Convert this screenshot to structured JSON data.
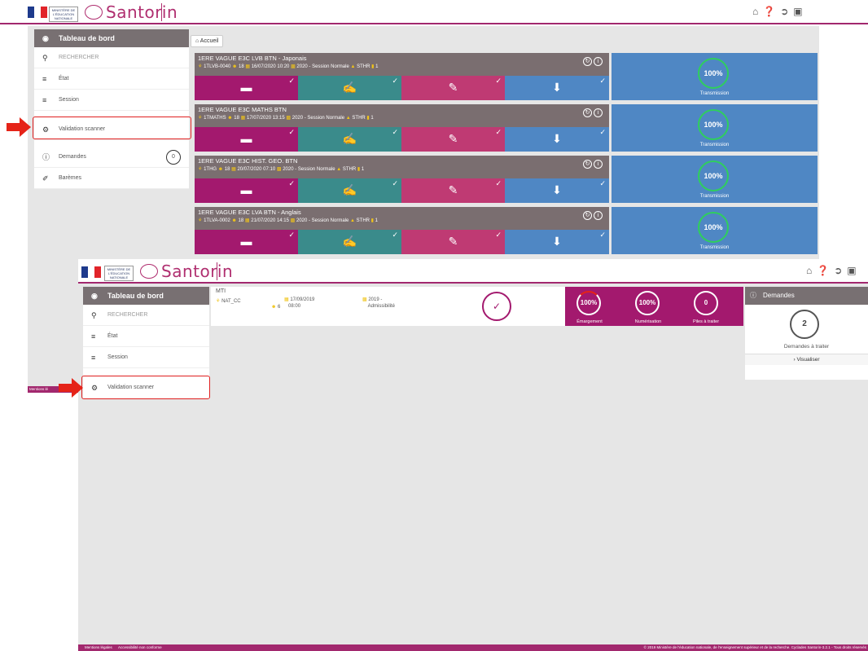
{
  "top": {
    "header": {
      "logo_text": "Santorin",
      "ministry_text": "MINISTÈRE DE L'ÉDUCATION NATIONALE",
      "icons": [
        "home-icon",
        "help-icon",
        "logout-icon",
        "window-icon"
      ]
    },
    "sidebar": {
      "title": "Tableau de bord",
      "items": [
        {
          "icon": "search-icon",
          "label": "RECHERCHER"
        },
        {
          "icon": "list-icon",
          "label": "État"
        },
        {
          "icon": "list-icon",
          "label": "Session"
        },
        {
          "icon": "gear-icon",
          "label": "Validation scanner"
        },
        {
          "icon": "alert-icon",
          "label": "Demandes",
          "badge": "0"
        },
        {
          "icon": "brush-icon",
          "label": "Barèmes"
        }
      ]
    },
    "breadcrumb": {
      "label": "Accueil"
    },
    "exams": [
      {
        "title": "1ERE VAGUE E3C LVB BTN - Japonais",
        "code": "1TLVB-0040",
        "count": "18",
        "date": "16/07/2020 10:20",
        "session": "2020 - Session Normale",
        "center": "STHR",
        "piles": "1"
      },
      {
        "title": "1ERE VAGUE E3C MATHS BTN",
        "code": "1TMATHS",
        "count": "18",
        "date": "17/07/2020 13:15",
        "session": "2020 - Session Normale",
        "center": "STHR",
        "piles": "1"
      },
      {
        "title": "1ERE VAGUE E3C HIST. GEO. BTN",
        "code": "1THG",
        "count": "18",
        "date": "20/07/2020 07:10",
        "session": "2020 - Session Normale",
        "center": "STHR",
        "piles": "1"
      },
      {
        "title": "1ERE VAGUE E3C LVA BTN - Anglais",
        "code": "1TLVA-0002",
        "count": "18",
        "date": "21/07/2020 14:15",
        "session": "2020 - Session Normale",
        "center": "STHR",
        "piles": "1"
      }
    ],
    "transmission": {
      "value": "100%",
      "label": "Transmission"
    }
  },
  "bottom": {
    "header": {
      "logo_text": "Santorin",
      "ministry_text": "MINISTÈRE DE L'ÉDUCATION NATIONALE"
    },
    "sidebar": {
      "title": "Tableau de bord",
      "items": [
        {
          "icon": "search-icon",
          "label": "RECHERCHER"
        },
        {
          "icon": "list-icon",
          "label": "État"
        },
        {
          "icon": "list-icon",
          "label": "Session"
        },
        {
          "icon": "gear-icon",
          "label": "Validation scanner"
        }
      ]
    },
    "left_footer_snippet": "Mentions lé",
    "session_card": {
      "name": "MTI",
      "code": "NAT_CC",
      "count": "6",
      "date": "17/09/2019",
      "time": "08:00",
      "session_line1": "2019 -",
      "session_line2": "Admissibilité"
    },
    "stats": [
      {
        "value": "100%",
        "label": "Émargement"
      },
      {
        "value": "100%",
        "label": "Numérisation"
      },
      {
        "value": "0",
        "label": "Piles à traiter"
      }
    ],
    "demandes": {
      "title": "Demandes",
      "count": "2",
      "label": "Demandes à traiter",
      "action": "Visualiser"
    },
    "footer": {
      "left_links": [
        "Mentions légales",
        "Accessibilité non conforme"
      ],
      "copyright": "© 2019 Ministère de l'éducation nationale, de l'enseignement supérieur et de la recherche. Cyclades Santorin-3.2.1 - Tous droits réservés"
    }
  },
  "colors": {
    "brand": "#a2286e",
    "sidebar_head": "#787072",
    "tile_scan": "#a3196e",
    "tile_teal": "#3a8b8b",
    "tile_pink": "#bf3a73",
    "tile_blue": "#4f87c4",
    "ring_green": "#2fcf5c",
    "highlight_red": "#e52318"
  }
}
